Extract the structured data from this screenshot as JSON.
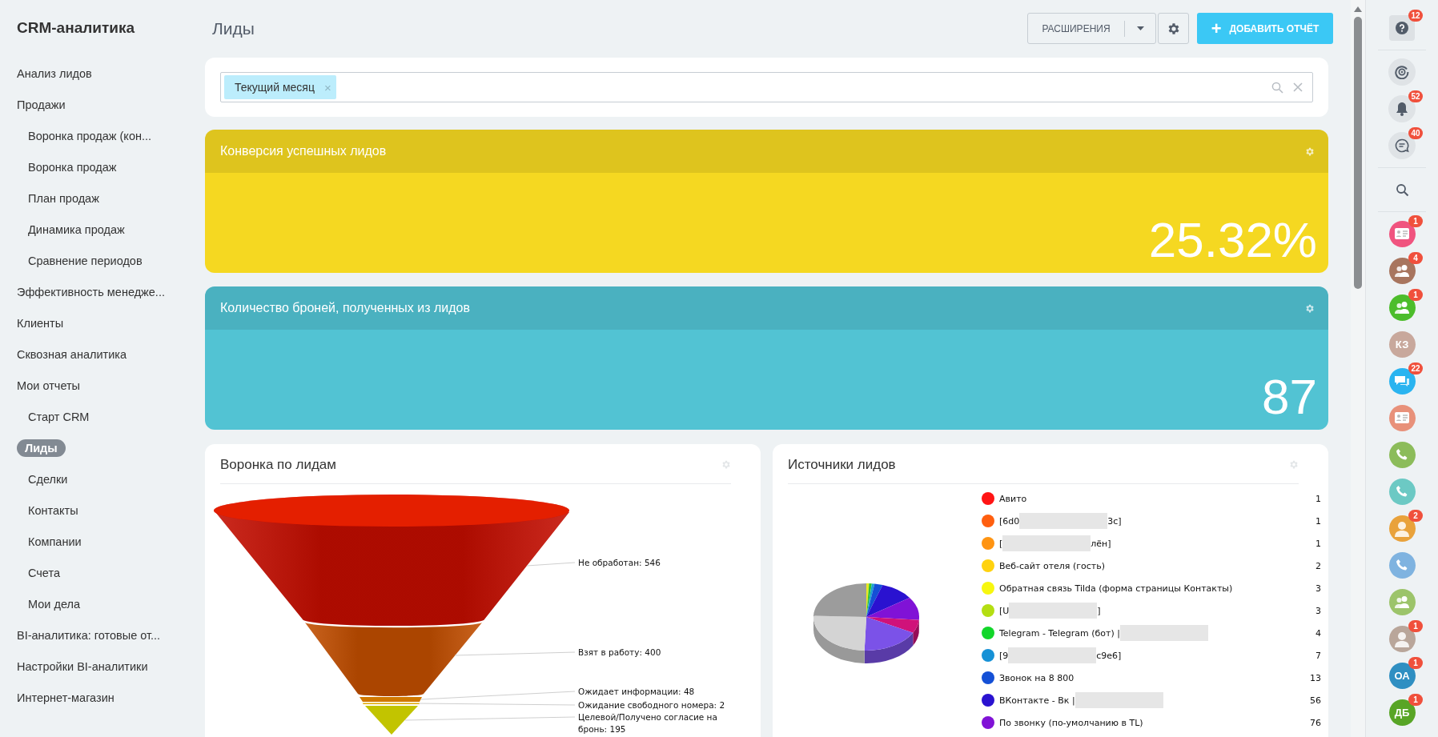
{
  "sidebar": {
    "title": "CRM-аналитика",
    "items": [
      {
        "label": "Анализ лидов",
        "selected": false
      },
      {
        "label": "Продажи",
        "selected": false,
        "children": [
          {
            "label": "Воронка продаж (кон...",
            "selected": false
          },
          {
            "label": "Воронка продаж",
            "selected": false
          },
          {
            "label": "План продаж",
            "selected": false
          },
          {
            "label": "Динамика продаж",
            "selected": false
          },
          {
            "label": "Сравнение периодов",
            "selected": false
          }
        ]
      },
      {
        "label": "Эффективность менедже...",
        "selected": false
      },
      {
        "label": "Клиенты",
        "selected": false
      },
      {
        "label": "Сквозная аналитика",
        "selected": false
      },
      {
        "label": "Мои отчеты",
        "selected": false,
        "children": [
          {
            "label": "Старт CRM",
            "selected": false
          },
          {
            "label": "Лиды",
            "selected": true
          },
          {
            "label": "Сделки",
            "selected": false
          },
          {
            "label": "Контакты",
            "selected": false
          },
          {
            "label": "Компании",
            "selected": false
          },
          {
            "label": "Счета",
            "selected": false
          },
          {
            "label": "Мои дела",
            "selected": false
          }
        ]
      },
      {
        "label": "BI-аналитика: готовые от...",
        "selected": false
      },
      {
        "label": "Настройки BI-аналитики",
        "selected": false
      },
      {
        "label": "Интернет-магазин",
        "selected": false
      }
    ]
  },
  "page": {
    "title": "Лиды"
  },
  "toolbar": {
    "extensions_button": "РАСШИРЕНИЯ",
    "add_button": "ДОБАВИТЬ ОТЧЁТ",
    "add_icon": "+"
  },
  "filter": {
    "tags": [
      {
        "label": "Текущий месяц",
        "remove": "×"
      }
    ]
  },
  "widgets": [
    {
      "title": "Конверсия успешных лидов",
      "value": "25.32%",
      "color": "#f5d821"
    },
    {
      "title": "Количество броней, полученных из лидов",
      "value": "87",
      "color": "#52c3d3"
    }
  ],
  "funnel": {
    "title": "Воронка по лидам",
    "stages": [
      {
        "label": "Не обработан: 546",
        "color": "#c40d00"
      },
      {
        "label": "Взят в работу: 400",
        "color": "#c24e00"
      },
      {
        "label": "Ожидает информации: 48",
        "color": "#d07800"
      },
      {
        "label": "Ожидание свободного номера: 2",
        "color": "#e0a800"
      },
      {
        "label": "Целевой/Получено согласие на",
        "label_2": "бронь: 195",
        "color": "#c2c400"
      }
    ]
  },
  "sources": {
    "title": "Источники лидов",
    "items": [
      {
        "segments": [
          {
            "kind": "text",
            "text": "Авито"
          }
        ],
        "count": "1",
        "color": "#ff1414"
      },
      {
        "segments": [
          {
            "kind": "text",
            "text": "[6d0"
          },
          {
            "kind": "blur"
          },
          {
            "kind": "text",
            "text": "3c]"
          }
        ],
        "count": "1",
        "color": "#ff5f0f"
      },
      {
        "segments": [
          {
            "kind": "text",
            "text": "["
          },
          {
            "kind": "blur"
          },
          {
            "kind": "text",
            "text": "лён]"
          }
        ],
        "count": "1",
        "color": "#ff9412"
      },
      {
        "segments": [
          {
            "kind": "text",
            "text": "Веб-сайт отеля (гость)"
          }
        ],
        "count": "2",
        "color": "#ffd20f"
      },
      {
        "segments": [
          {
            "kind": "text",
            "text": "Обратная связь Tilda (форма страницы Контакты)"
          }
        ],
        "count": "3",
        "color": "#f7f70f"
      },
      {
        "segments": [
          {
            "kind": "text",
            "text": "[U"
          },
          {
            "kind": "blur"
          },
          {
            "kind": "text",
            "text": "]"
          }
        ],
        "count": "3",
        "color": "#b4de12"
      },
      {
        "segments": [
          {
            "kind": "text",
            "text": "Telegram - Telegram (бот) |"
          },
          {
            "kind": "blur"
          }
        ],
        "count": "4",
        "color": "#12d62a"
      },
      {
        "segments": [
          {
            "kind": "text",
            "text": "[9"
          },
          {
            "kind": "blur"
          },
          {
            "kind": "text",
            "text": "c9e6]"
          }
        ],
        "count": "7",
        "color": "#1691d6"
      },
      {
        "segments": [
          {
            "kind": "text",
            "text": "Звонок на 8 800"
          }
        ],
        "count": "13",
        "color": "#1450d6"
      },
      {
        "segments": [
          {
            "kind": "text",
            "text": "ВКонтакте - Вк |"
          },
          {
            "kind": "blur"
          }
        ],
        "count": "56",
        "color": "#2a12d0"
      },
      {
        "segments": [
          {
            "kind": "text",
            "text": "По звонку (по-умолчанию в TL)"
          }
        ],
        "count": "76",
        "color": "#8012d6"
      }
    ]
  },
  "right_panel": {
    "groups": [
      [
        {
          "kind": "help",
          "badge": "12"
        }
      ],
      [
        {
          "kind": "target"
        },
        {
          "kind": "bell",
          "badge": "52"
        },
        {
          "kind": "chat-list",
          "badge": "40"
        }
      ],
      [
        {
          "kind": "search"
        }
      ],
      [
        {
          "kind": "card",
          "color": "#f0547f",
          "badge": "1"
        },
        {
          "kind": "people",
          "color": "#a8755e",
          "badge": "4"
        },
        {
          "kind": "people",
          "color": "#4cbd2b",
          "badge": "1"
        },
        {
          "kind": "initials",
          "initials": "КЗ",
          "color": "#c8a89c"
        },
        {
          "kind": "chat",
          "color": "#2ab4f0",
          "badge": "22"
        },
        {
          "kind": "card",
          "color": "#e8917a"
        },
        {
          "kind": "phone",
          "color": "#8cbc5a"
        },
        {
          "kind": "phone",
          "color": "#6cc9c4"
        },
        {
          "kind": "person",
          "color": "#e9a23b",
          "badge": "2"
        },
        {
          "kind": "phone",
          "color": "#7fb3e0"
        },
        {
          "kind": "people",
          "color": "#9cc46a"
        },
        {
          "kind": "person",
          "color": "#b9a69a",
          "badge": "1"
        },
        {
          "kind": "initials",
          "initials": "ОА",
          "color": "#2f8fc2",
          "badge": "1"
        },
        {
          "kind": "initials",
          "initials": "ДБ",
          "color": "#58a526",
          "badge": "1"
        }
      ]
    ]
  }
}
